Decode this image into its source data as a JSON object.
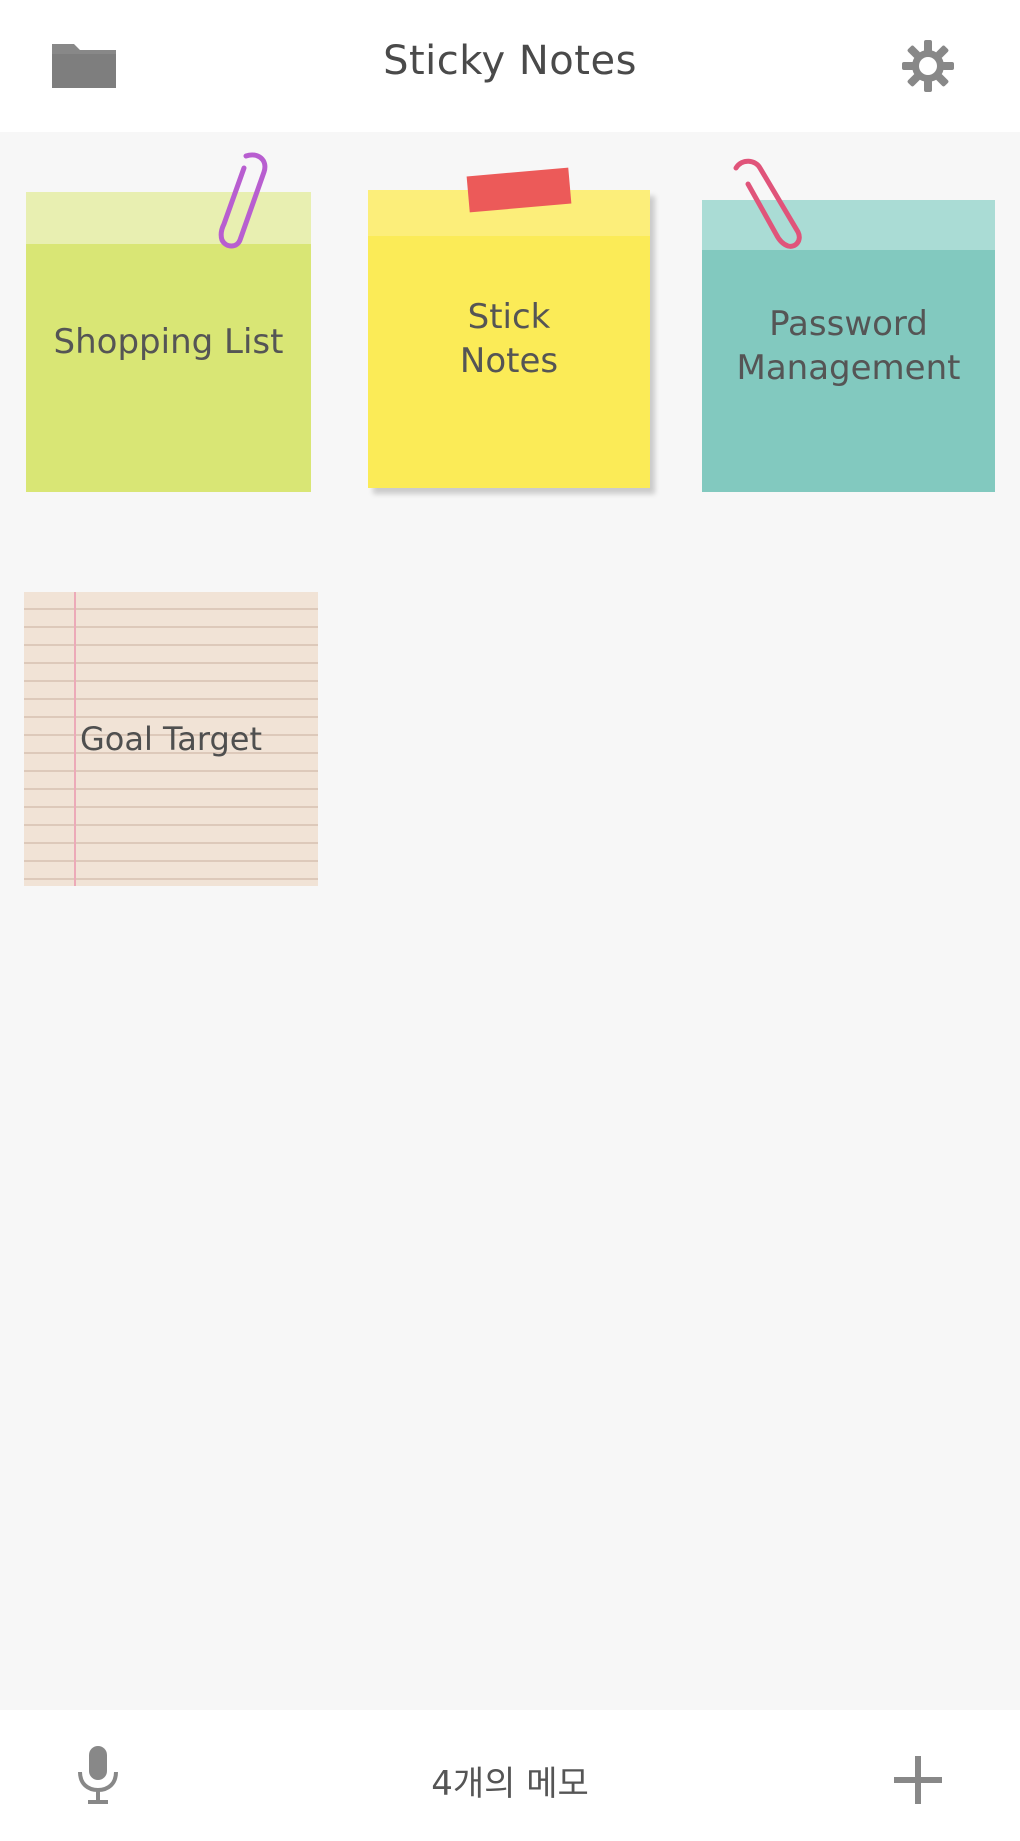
{
  "header": {
    "title": "Sticky Notes",
    "folder_icon": "folder-icon",
    "settings_icon": "gear-icon"
  },
  "notes": [
    {
      "label": "Shopping List",
      "color": "#d9e675",
      "attachment": "purple paperclip"
    },
    {
      "label": "Stick\nNotes",
      "color": "#fbeb57",
      "attachment": "red tape"
    },
    {
      "label": "Password\nManagement",
      "color": "#82c9bf",
      "attachment": "pink paperclip"
    },
    {
      "label": "Goal Target",
      "color": "#f1e3d6",
      "attachment": "none",
      "style": "lined paper"
    }
  ],
  "footer": {
    "memo_count": "4개의 메모",
    "mic_icon": "microphone-icon",
    "add_icon": "plus-icon"
  },
  "colors": {
    "background": "#f7f7f7",
    "bar": "#ffffff",
    "icon": "#888888",
    "paperclip_purple": "#b85ed0",
    "paperclip_pink": "#e0547a",
    "tape": "#ec5a59"
  }
}
